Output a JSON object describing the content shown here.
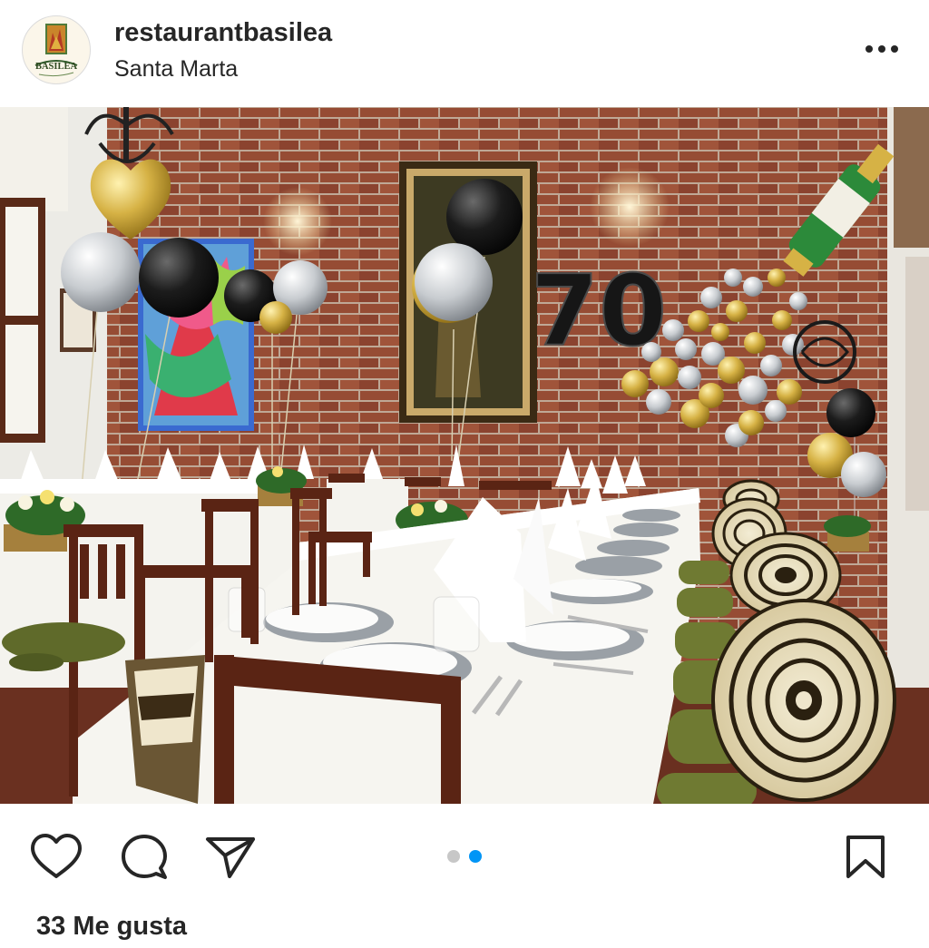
{
  "post": {
    "username": "restaurantbasilea",
    "location": "Santa Marta",
    "avatar_logo_text": "BASILEA",
    "likes_text": "33 Me gusta"
  },
  "photo": {
    "balloon_number": "70"
  },
  "carousel": {
    "total": 2,
    "active_index": 1
  },
  "icons": {
    "more": "more-horizontal-icon",
    "like": "heart-icon",
    "comment": "comment-bubble-icon",
    "share": "paper-plane-icon",
    "save": "bookmark-icon"
  },
  "colors": {
    "text": "#262626",
    "dot_active": "#0095f6",
    "dot_inactive": "#c7c7c7"
  }
}
